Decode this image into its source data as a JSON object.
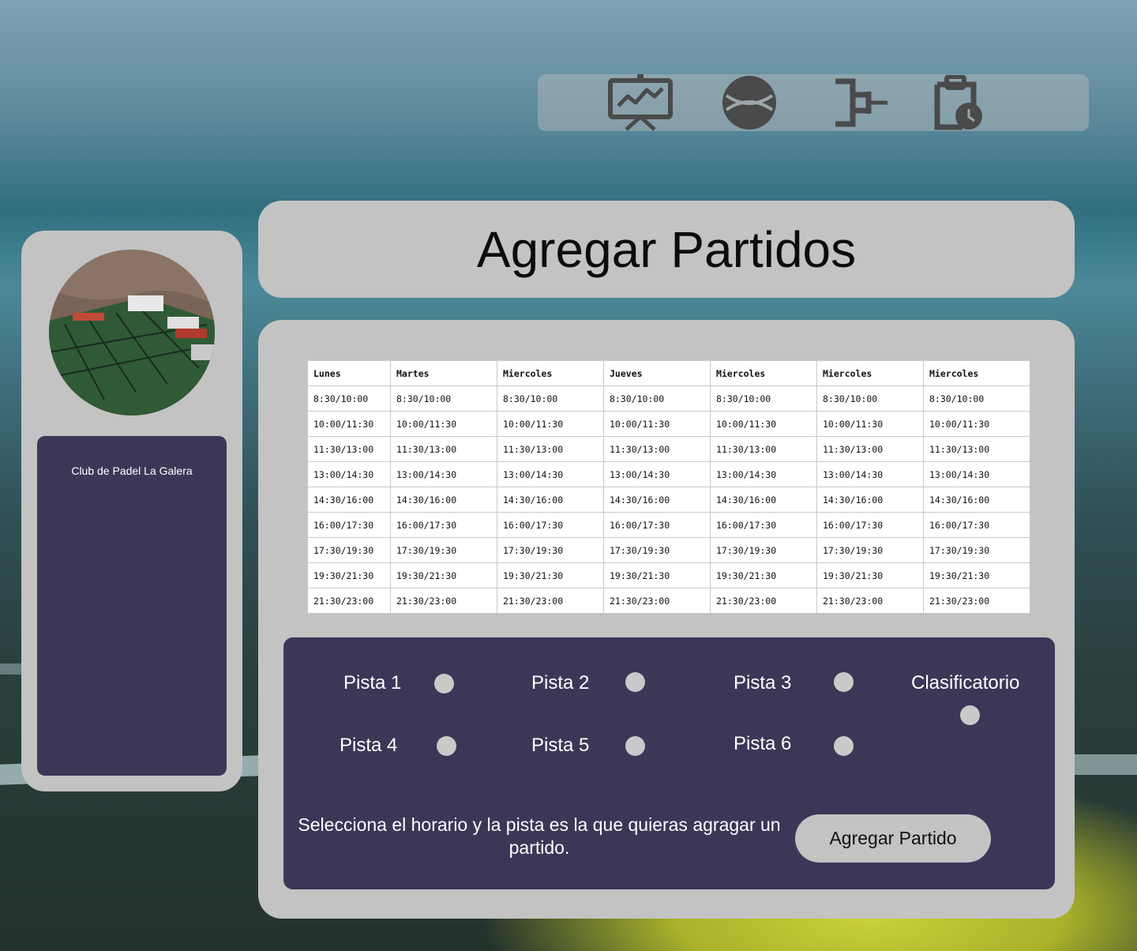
{
  "nav": {
    "icons": [
      "presentation-chart-icon",
      "baseball-icon",
      "tournament-bracket-icon",
      "clipboard-clock-icon"
    ]
  },
  "sidebar": {
    "club_name": "Club de Padel La Galera"
  },
  "header": {
    "title": "Agregar Partidos"
  },
  "schedule": {
    "days": [
      "Lunes",
      "Martes",
      "Miercoles",
      "Jueves",
      "Miercoles",
      "Miercoles",
      "Miercoles"
    ],
    "slots": [
      "8:30/10:00",
      "10:00/11:30",
      "11:30/13:00",
      "13:00/14:30",
      "14:30/16:00",
      "16:00/17:30",
      "17:30/19:30",
      "19:30/21:30",
      "21:30/23:00"
    ]
  },
  "courts": {
    "pista1": "Pista 1",
    "pista2": "Pista 2",
    "pista3": "Pista 3",
    "pista4": "Pista 4",
    "pista5": "Pista 5",
    "pista6": "Pista 6",
    "clasificatorio": "Clasificatorio"
  },
  "instruction": "Selecciona el horario y la pista es la que quieras agragar un partido.",
  "add_button_label": "Agregar Partido",
  "colors": {
    "panel_gray": "#c3c3c3",
    "panel_dark": "#3c3757",
    "icon_gray": "#4a4a4a"
  }
}
